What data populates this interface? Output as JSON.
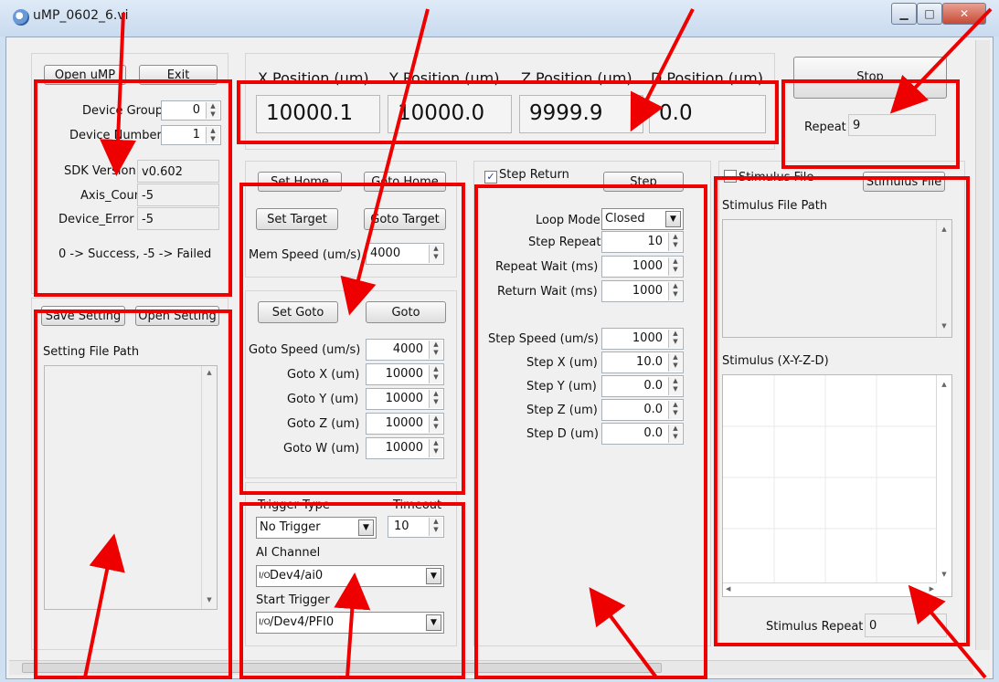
{
  "window": {
    "title": "uMP_0602_6.vi"
  },
  "device": {
    "open_label": "Open uMP",
    "exit_label": "Exit",
    "group_label": "Device Group",
    "group_value": "0",
    "number_label": "Device Number",
    "number_value": "1",
    "sdk_label": "SDK Version",
    "sdk_value": "v0.602",
    "axis_label": "Axis_Count",
    "axis_value": "-5",
    "error_label": "Device_Error",
    "error_value": "-5",
    "legend": "0 -> Success,  -5 -> Failed"
  },
  "settings": {
    "save_label": "Save Setting",
    "open_label": "Open Setting",
    "path_label": "Setting File Path"
  },
  "position": {
    "x_label": "X Position (um)",
    "y_label": "Y Position (um)",
    "z_label": "Z Position (um)",
    "d_label": "D Position (um)",
    "x": "10000.1",
    "y": "10000.0",
    "z": "9999.9",
    "d": "0.0"
  },
  "stop": {
    "label": "Stop",
    "repeat_label": "Repeat",
    "repeat_value": "9"
  },
  "home": {
    "set_home": "Set Home",
    "goto_home": "Goto Home",
    "set_target": "Set Target",
    "goto_target": "Goto Target",
    "mem_speed_label": "Mem Speed (um/s)",
    "mem_speed": "4000"
  },
  "goto": {
    "set_goto": "Set Goto",
    "goto": "Goto",
    "speed_label": "Goto Speed (um/s)",
    "speed": "4000",
    "x_label": "Goto X (um)",
    "x": "10000",
    "y_label": "Goto Y (um)",
    "y": "10000",
    "z_label": "Goto Z (um)",
    "z": "10000",
    "w_label": "Goto W (um)",
    "w": "10000"
  },
  "trigger": {
    "type_label": "Trigger Type",
    "timeout_label": "Timeout",
    "type_value": "No Trigger",
    "timeout_value": "10",
    "ai_label": "AI Channel",
    "ai_value": "Dev4/ai0",
    "start_label": "Start Trigger",
    "start_value": "/Dev4/PFI0"
  },
  "step": {
    "return_label": "Step Return",
    "return_checked": true,
    "step_button": "Step",
    "loop_label": "Loop Mode",
    "loop_value": "Closed",
    "repeat_label": "Step Repeat",
    "repeat": "10",
    "repeat_wait_label": "Repeat Wait (ms)",
    "repeat_wait": "1000",
    "return_wait_label": "Return Wait (ms)",
    "return_wait": "1000",
    "speed_label": "Step Speed (um/s)",
    "speed": "1000",
    "x_label": "Step X (um)",
    "x": "10.0",
    "y_label": "Step Y (um)",
    "y": "0.0",
    "z_label": "Step Z (um)",
    "z": "0.0",
    "d_label": "Step D (um)",
    "d": "0.0"
  },
  "stimulus": {
    "file_check_label": "Stimulus File",
    "file_button": "Stimulus File",
    "path_label": "Stimulus File Path",
    "graph_label": "Stimulus (X-Y-Z-D)",
    "repeat_label": "Stimulus Repeat",
    "repeat_value": "0"
  },
  "annotation_color": "#ee0000"
}
